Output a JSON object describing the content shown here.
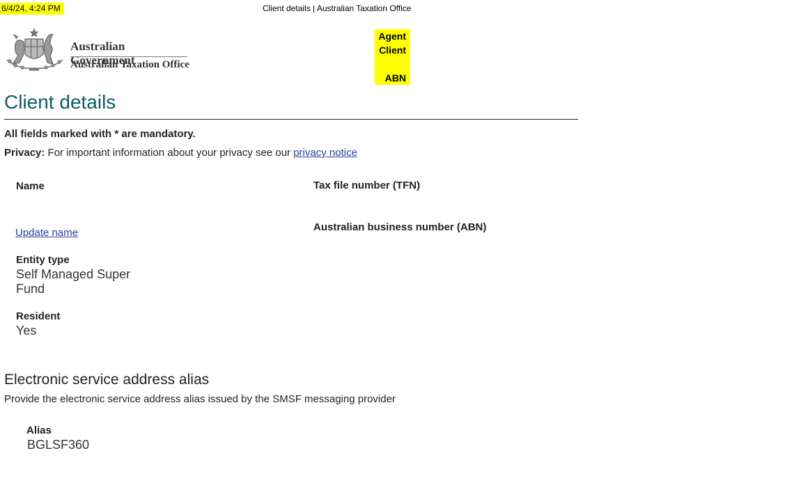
{
  "print_header": {
    "datetime": "6/4/24, 4:24 PM",
    "title": "Client details | Australian Taxation Office"
  },
  "logo": {
    "line1": "Australian Government",
    "line2": "Australian Taxation Office",
    "icon": "coat-of-arms-icon"
  },
  "highlight_box": {
    "agent": "Agent",
    "client": "Client",
    "abn": "ABN",
    "color": "#ffff00"
  },
  "page": {
    "title": "Client details",
    "mandatory_note": "All fields marked with * are mandatory.",
    "privacy_label": "Privacy:",
    "privacy_text": "For important information about your privacy see our",
    "privacy_link": "privacy notice"
  },
  "details": {
    "name_label": "Name",
    "update_name_link": "Update name",
    "entity_type_label": "Entity type",
    "entity_type_line1": "Self Managed Super",
    "entity_type_line2": "Fund",
    "resident_label": "Resident",
    "resident_value": "Yes",
    "tfn_label": "Tax file number (TFN)",
    "abn_label": "Australian business number (ABN)"
  },
  "esa": {
    "heading": "Electronic service address alias",
    "description": "Provide the electronic service address alias issued by the SMSF messaging provider",
    "alias_label": "Alias",
    "alias_value": "BGLSF360"
  },
  "colors": {
    "title": "#0f5a6b",
    "link": "#2a3d9c",
    "highlight": "#ffff00"
  }
}
